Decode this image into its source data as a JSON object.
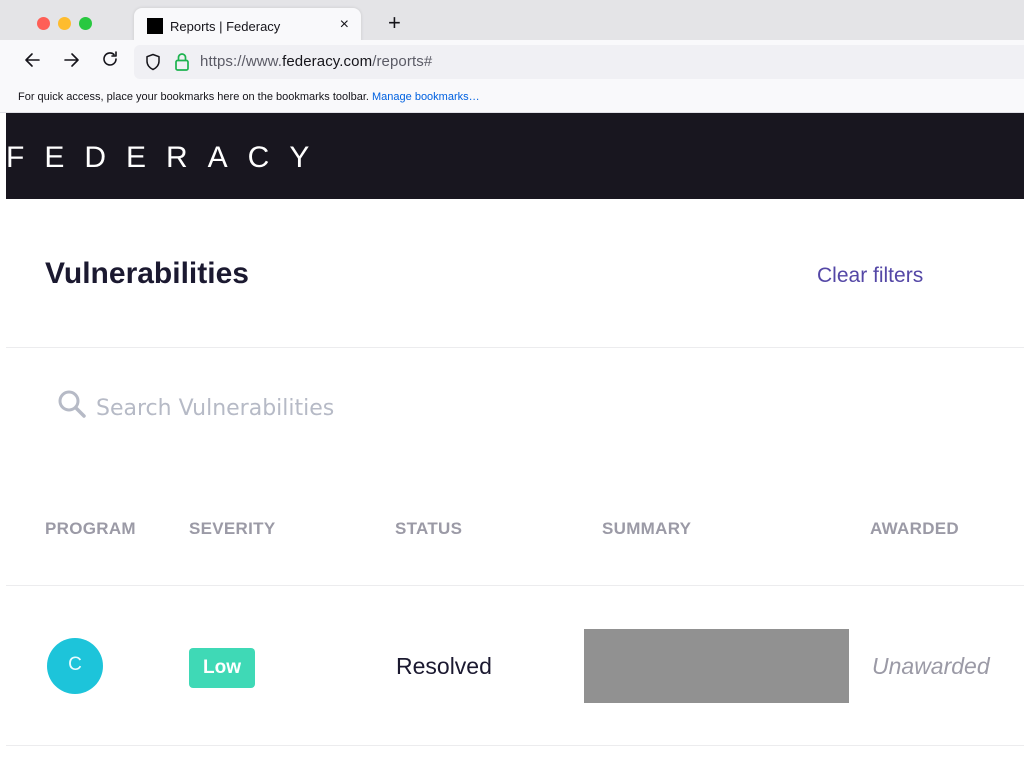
{
  "browser": {
    "tab_title": "Reports | Federacy",
    "tab_close": "×",
    "new_tab": "+",
    "url_prefix": "https://www.",
    "url_domain": "federacy.com",
    "url_path": "/reports#",
    "bookmarks_text": "For quick access, place your bookmarks here on the bookmarks toolbar.",
    "bookmarks_link": "Manage bookmarks…"
  },
  "brand": {
    "name": "FEDERACY"
  },
  "page": {
    "title": "Vulnerabilities",
    "clear_filters": "Clear filters"
  },
  "search": {
    "placeholder": "Search Vulnerabilities"
  },
  "table": {
    "columns": [
      "PROGRAM",
      "SEVERITY",
      "STATUS",
      "SUMMARY",
      "AWARDED"
    ],
    "rows": [
      {
        "program_initial": "C",
        "severity": "Low",
        "status": "Resolved",
        "awarded": "Unawarded"
      }
    ]
  },
  "colors": {
    "brand_bar": "#18161f",
    "accent_link": "#5447a6",
    "severity_low": "#3fd9b6",
    "program_avatar": "#1dc4da"
  },
  "icons": [
    "back-arrow-icon",
    "forward-arrow-icon",
    "reload-icon",
    "shield-icon",
    "lock-icon",
    "search-icon",
    "close-icon"
  ]
}
